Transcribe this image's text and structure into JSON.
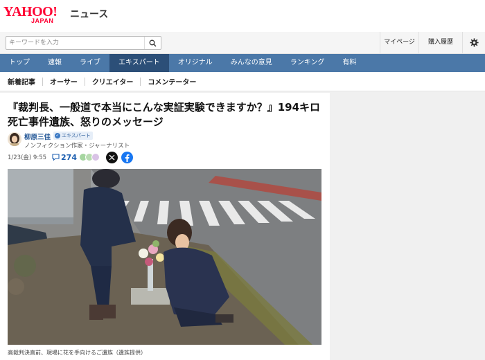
{
  "header": {
    "logo_main": "YAHOO!",
    "logo_sub": "JAPAN",
    "service_name": "ニュース",
    "search_placeholder": "キーワードを入力",
    "links": [
      "マイページ",
      "購入履歴"
    ]
  },
  "main_nav": [
    "トップ",
    "速報",
    "ライブ",
    "エキスパート",
    "オリジナル",
    "みんなの意見",
    "ランキング",
    "有料"
  ],
  "main_nav_active": "エキスパート",
  "sub_nav": [
    "新着記事",
    "オーサー",
    "クリエイター",
    "コメンテーター"
  ],
  "article": {
    "title": "『裁判長、一般道で本当にこんな実証実験できますか？』194キロ死亡事件遺族、怒りのメッセージ",
    "author": {
      "name": "柳原三佳",
      "badge": "エキスパート",
      "role": "ノンフィクション作家・ジャーナリスト"
    },
    "date": "1/23(金) 9:55",
    "comment_count": "274",
    "share": [
      "x-icon",
      "facebook-icon"
    ],
    "caption": "高裁判決直前、現場に花を手向けるご遺族（遺族提供）"
  },
  "colors": {
    "brand_red": "#ff0033",
    "nav_blue": "#4b78a8",
    "nav_active": "#2c4f78",
    "link_blue": "#2a5c9a"
  }
}
